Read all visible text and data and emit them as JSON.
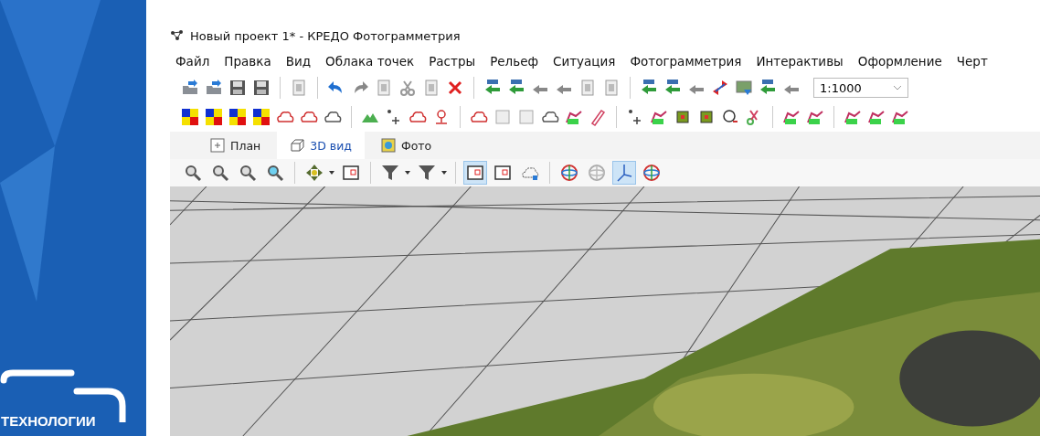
{
  "brand": {
    "text": "ТЕХНОЛОГИИ"
  },
  "window": {
    "title": "Новый проект 1* - КРЕДО Фотограмметрия"
  },
  "menu": [
    "Файл",
    "Правка",
    "Вид",
    "Облака точек",
    "Растры",
    "Рельеф",
    "Ситуация",
    "Фотограмметрия",
    "Интерактивы",
    "Оформление",
    "Черт"
  ],
  "scale": {
    "value": "1:1000"
  },
  "tabs": [
    {
      "label": "План",
      "selected": false
    },
    {
      "label": "3D вид",
      "selected": true
    },
    {
      "label": "Фото",
      "selected": false
    }
  ],
  "view_toolbar": [
    {
      "selected": false
    },
    {
      "selected": false
    },
    {
      "selected": false
    },
    {
      "selected": false
    },
    {
      "selected": false
    },
    {
      "selected": false
    },
    {
      "selected": false
    },
    {
      "selected": false
    },
    {
      "selected": true
    },
    {
      "selected": false
    },
    {
      "selected": false
    },
    {
      "selected": false
    },
    {
      "selected": false
    },
    {
      "selected": true
    },
    {
      "selected": false
    }
  ]
}
